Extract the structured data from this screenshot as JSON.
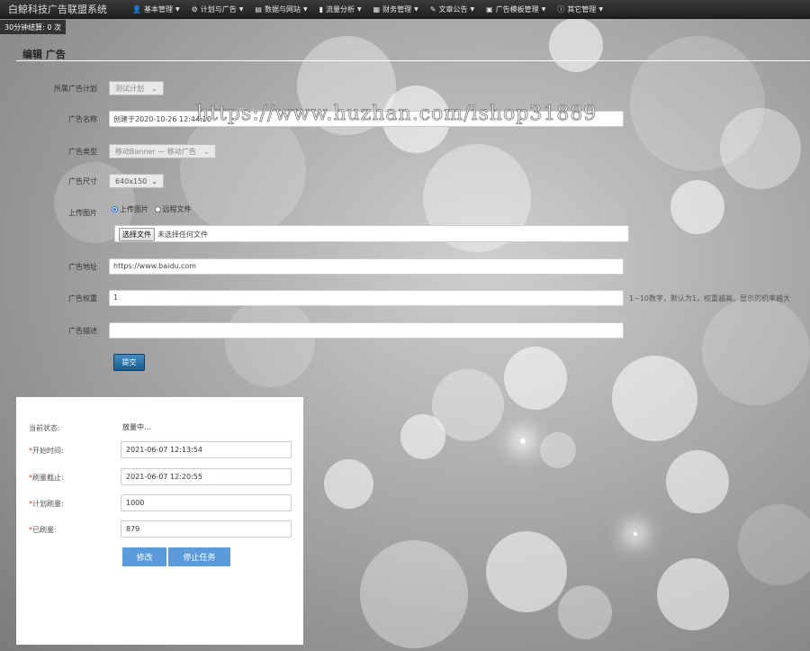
{
  "nav": {
    "brand": "白鲸科技广告联盟系统",
    "items": [
      {
        "label": "基本管理",
        "icon": "user-icon",
        "glyph": "👤"
      },
      {
        "label": "计划与广告",
        "icon": "gear-icon",
        "glyph": "⚙"
      },
      {
        "label": "数据与网站",
        "icon": "document-icon",
        "glyph": "▤"
      },
      {
        "label": "流量分析",
        "icon": "bar-chart-icon",
        "glyph": "▮"
      },
      {
        "label": "财务管理",
        "icon": "grid-icon",
        "glyph": "▦"
      },
      {
        "label": "文章公告",
        "icon": "pencil-icon",
        "glyph": "✎"
      },
      {
        "label": "广告模板管理",
        "icon": "image-icon",
        "glyph": "▣"
      },
      {
        "label": "其它管理",
        "icon": "info-icon",
        "glyph": "ⓘ"
      }
    ]
  },
  "stat": "30分钟结算: 0 次",
  "page_title": "编辑 广告",
  "watermark": "https://www.huzhan.com/ishop31889",
  "form": {
    "plan_label": "所属广告计划",
    "plan_value": "测试计划",
    "name_label": "广告名称",
    "name_value": "创建于2020-10-26 12:44:20",
    "type_label": "广告类型",
    "type_value": "移动Banner — 移动广告",
    "size_label": "广告尺寸",
    "size_value": "640x150",
    "image_label": "上传图片",
    "radio_upload": "上传图片",
    "radio_remote": "远程文件",
    "file_button": "选择文件",
    "file_status": "未选择任何文件",
    "url_label": "广告地址",
    "url_value": "https://www.baidu.com",
    "weight_label": "广告权重",
    "weight_value": "1",
    "weight_hint": "1~10数字，默认为1，权重越高，显示的机率越大",
    "desc_label": "广告描述",
    "desc_value": "",
    "submit": "提交"
  },
  "panel": {
    "status_label": "当前状态:",
    "status_value": "放量中...",
    "start_label": "开始时间:",
    "start_value": "2021-06-07 12:13:54",
    "end_label": "刷量截止:",
    "end_value": "2021-06-07 12:20:55",
    "plan_count_label": "计划刷量:",
    "plan_count_value": "1000",
    "done_label": "已刷量:",
    "done_value": "879",
    "modify_button": "修改",
    "stop_button": "停止任务"
  }
}
